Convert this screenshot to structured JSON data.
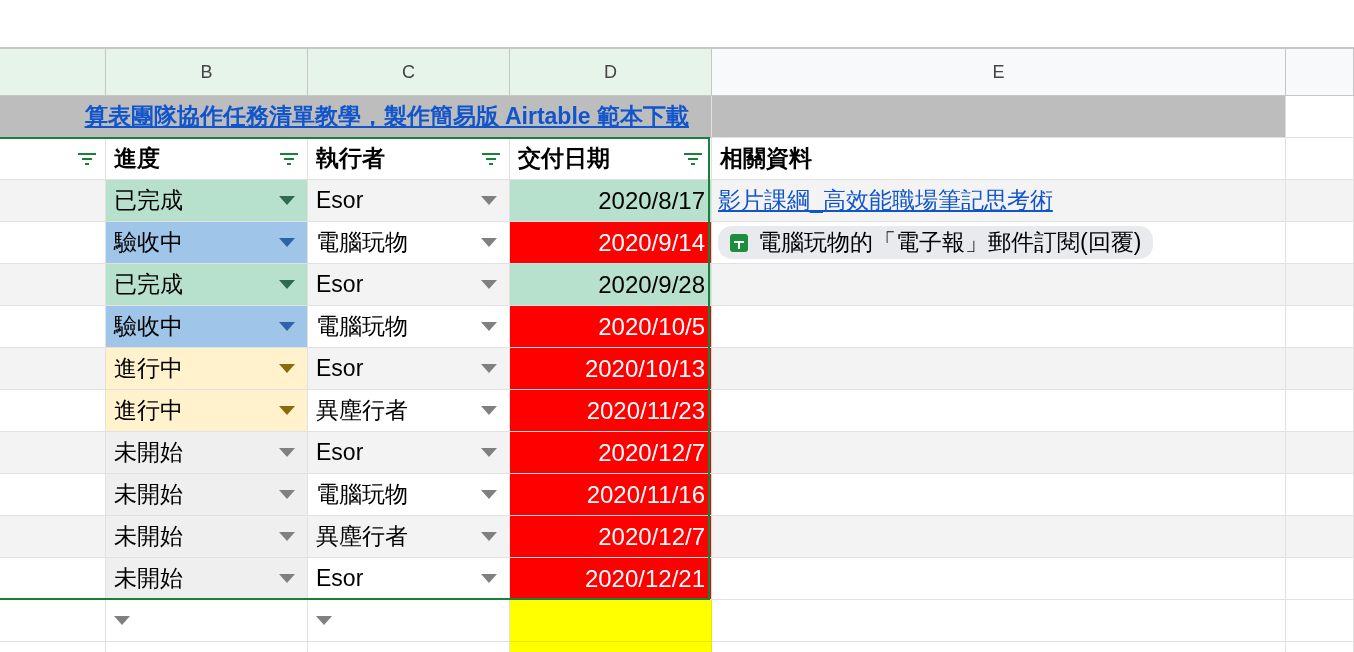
{
  "column_headers": [
    {
      "label": "B",
      "filtered": true
    },
    {
      "label": "C",
      "filtered": true
    },
    {
      "label": "D",
      "filtered": true
    },
    {
      "label": "E",
      "filtered": false
    }
  ],
  "title_link": "算表團隊協作任務清單教學，製作簡易版 Airtable 範本下載",
  "table": {
    "columns": [
      "進度",
      "執行者",
      "交付日期",
      "相關資料"
    ],
    "rows": [
      {
        "status": "已完成",
        "color": "#b7e1cd",
        "assignee": "Esor",
        "date": "2020/8/17",
        "overdue": false,
        "related": {
          "kind": "link",
          "text": "影片課綱_高效能職場筆記思考術"
        }
      },
      {
        "status": "驗收中",
        "color": "#9fc5e8",
        "assignee": "電腦玩物",
        "date": "2020/9/14",
        "overdue": true,
        "related": {
          "kind": "chip",
          "text": "電腦玩物的「電子報」郵件訂閱(回覆)"
        }
      },
      {
        "status": "已完成",
        "color": "#b7e1cd",
        "assignee": "Esor",
        "date": "2020/9/28",
        "overdue": false
      },
      {
        "status": "驗收中",
        "color": "#9fc5e8",
        "assignee": "電腦玩物",
        "date": "2020/10/5",
        "overdue": true
      },
      {
        "status": "進行中",
        "color": "#fff2cc",
        "assignee": "Esor",
        "date": "2020/10/13",
        "overdue": true
      },
      {
        "status": "進行中",
        "color": "#fff2cc",
        "assignee": "異塵行者",
        "date": "2020/11/23",
        "overdue": true
      },
      {
        "status": "未開始",
        "color": "#efefef",
        "assignee": "Esor",
        "date": "2020/12/7",
        "overdue": true
      },
      {
        "status": "未開始",
        "color": "#efefef",
        "assignee": "電腦玩物",
        "date": "2020/11/16",
        "overdue": true
      },
      {
        "status": "未開始",
        "color": "#efefef",
        "assignee": "異塵行者",
        "date": "2020/12/7",
        "overdue": true
      },
      {
        "status": "未開始",
        "color": "#efefef",
        "assignee": "Esor",
        "date": "2020/12/21",
        "overdue": true
      }
    ]
  }
}
